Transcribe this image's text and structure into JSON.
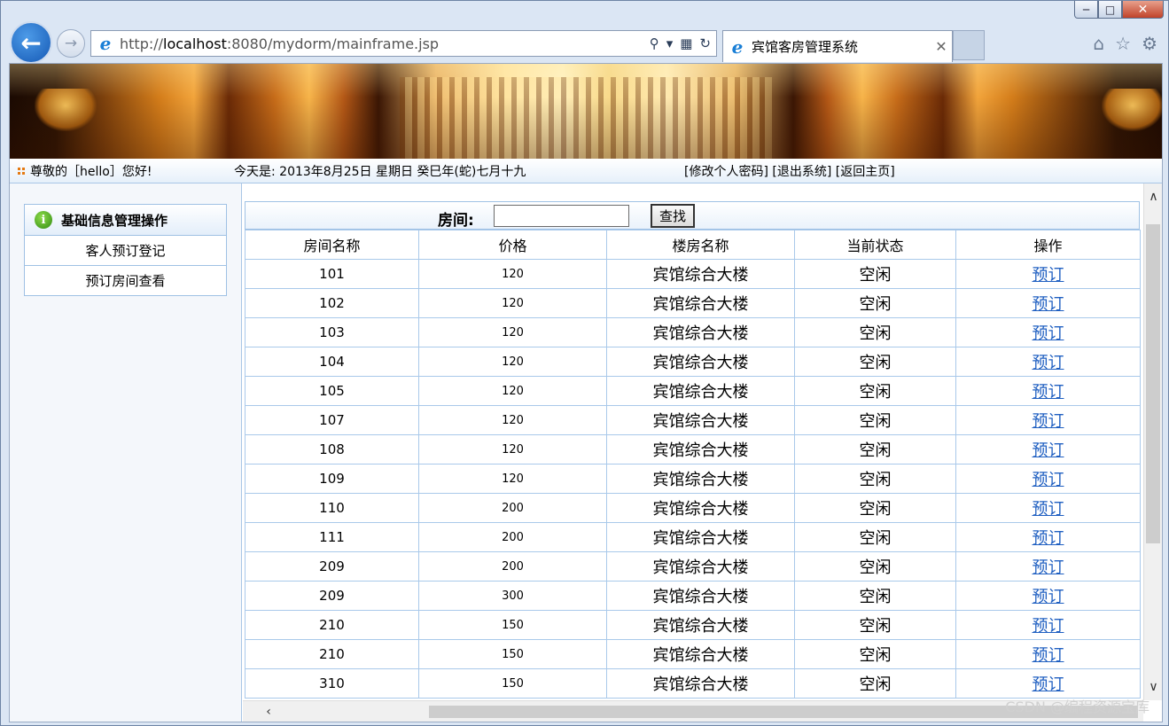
{
  "browser": {
    "address": {
      "prefix": "http://",
      "host": "localhost",
      "rest": ":8080/mydorm/mainframe.jsp"
    },
    "tab_title": "宾馆客房管理系统"
  },
  "info_bar": {
    "greeting": "尊敬的［hello］您好!",
    "today": "今天是:  2013年8月25日  星期日  癸巳年(蛇)七月十九",
    "links": "[修改个人密码] [退出系统] [返回主页]"
  },
  "sidebar": {
    "header": "基础信息管理操作",
    "items": [
      {
        "label": "客人预订登记"
      },
      {
        "label": "预订房间查看"
      }
    ]
  },
  "search": {
    "label": "房间:",
    "value": "",
    "button": "查找"
  },
  "table": {
    "headers": [
      "房间名称",
      "价格",
      "楼房名称",
      "当前状态",
      "操作"
    ],
    "rows": [
      {
        "name": "101",
        "price": "120",
        "building": "宾馆综合大楼",
        "status": "空闲",
        "action": "预订"
      },
      {
        "name": "102",
        "price": "120",
        "building": "宾馆综合大楼",
        "status": "空闲",
        "action": "预订"
      },
      {
        "name": "103",
        "price": "120",
        "building": "宾馆综合大楼",
        "status": "空闲",
        "action": "预订"
      },
      {
        "name": "104",
        "price": "120",
        "building": "宾馆综合大楼",
        "status": "空闲",
        "action": "预订"
      },
      {
        "name": "105",
        "price": "120",
        "building": "宾馆综合大楼",
        "status": "空闲",
        "action": "预订"
      },
      {
        "name": "107",
        "price": "120",
        "building": "宾馆综合大楼",
        "status": "空闲",
        "action": "预订"
      },
      {
        "name": "108",
        "price": "120",
        "building": "宾馆综合大楼",
        "status": "空闲",
        "action": "预订"
      },
      {
        "name": "109",
        "price": "120",
        "building": "宾馆综合大楼",
        "status": "空闲",
        "action": "预订"
      },
      {
        "name": "110",
        "price": "200",
        "building": "宾馆综合大楼",
        "status": "空闲",
        "action": "预订"
      },
      {
        "name": "111",
        "price": "200",
        "building": "宾馆综合大楼",
        "status": "空闲",
        "action": "预订"
      },
      {
        "name": "209",
        "price": "200",
        "building": "宾馆综合大楼",
        "status": "空闲",
        "action": "预订"
      },
      {
        "name": "209",
        "price": "300",
        "building": "宾馆综合大楼",
        "status": "空闲",
        "action": "预订"
      },
      {
        "name": "210",
        "price": "150",
        "building": "宾馆综合大楼",
        "status": "空闲",
        "action": "预订"
      },
      {
        "name": "210",
        "price": "150",
        "building": "宾馆综合大楼",
        "status": "空闲",
        "action": "预订"
      },
      {
        "name": "310",
        "price": "150",
        "building": "宾馆综合大楼",
        "status": "空闲",
        "action": "预订"
      }
    ]
  },
  "watermark": "CSDN @编程资源宝库",
  "colors": {
    "link": "#1f5fc1",
    "table_border": "#a9c9ea",
    "info_bullet": "#e57a12",
    "back_button": "#1559b5"
  }
}
